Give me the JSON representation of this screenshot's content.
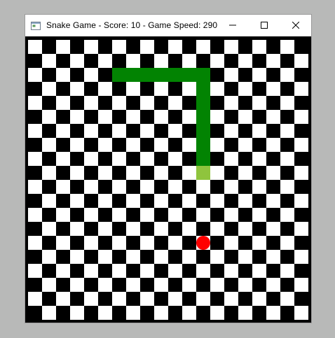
{
  "window": {
    "title": "Snake Game - Score: 10 - Game Speed: 290",
    "icon": "window-app-icon",
    "controls": {
      "minimize_icon": "minimize-icon",
      "maximize_icon": "maximize-icon",
      "close_icon": "close-icon"
    }
  },
  "game": {
    "score": 10,
    "game_speed": 290,
    "grid_cells": 20,
    "colors": {
      "board_dark": "#000000",
      "board_light": "#ffffff",
      "snake_body": "#028302",
      "snake_head": "#8fc43d",
      "food": "#ff0000"
    },
    "snake": {
      "head": [
        12,
        9
      ],
      "body": [
        [
          12,
          8
        ],
        [
          12,
          7
        ],
        [
          12,
          6
        ],
        [
          12,
          5
        ],
        [
          12,
          4
        ],
        [
          12,
          3
        ],
        [
          12,
          2
        ],
        [
          11,
          2
        ],
        [
          10,
          2
        ],
        [
          9,
          2
        ],
        [
          8,
          2
        ],
        [
          7,
          2
        ],
        [
          6,
          2
        ]
      ]
    },
    "food": [
      12,
      14
    ]
  }
}
